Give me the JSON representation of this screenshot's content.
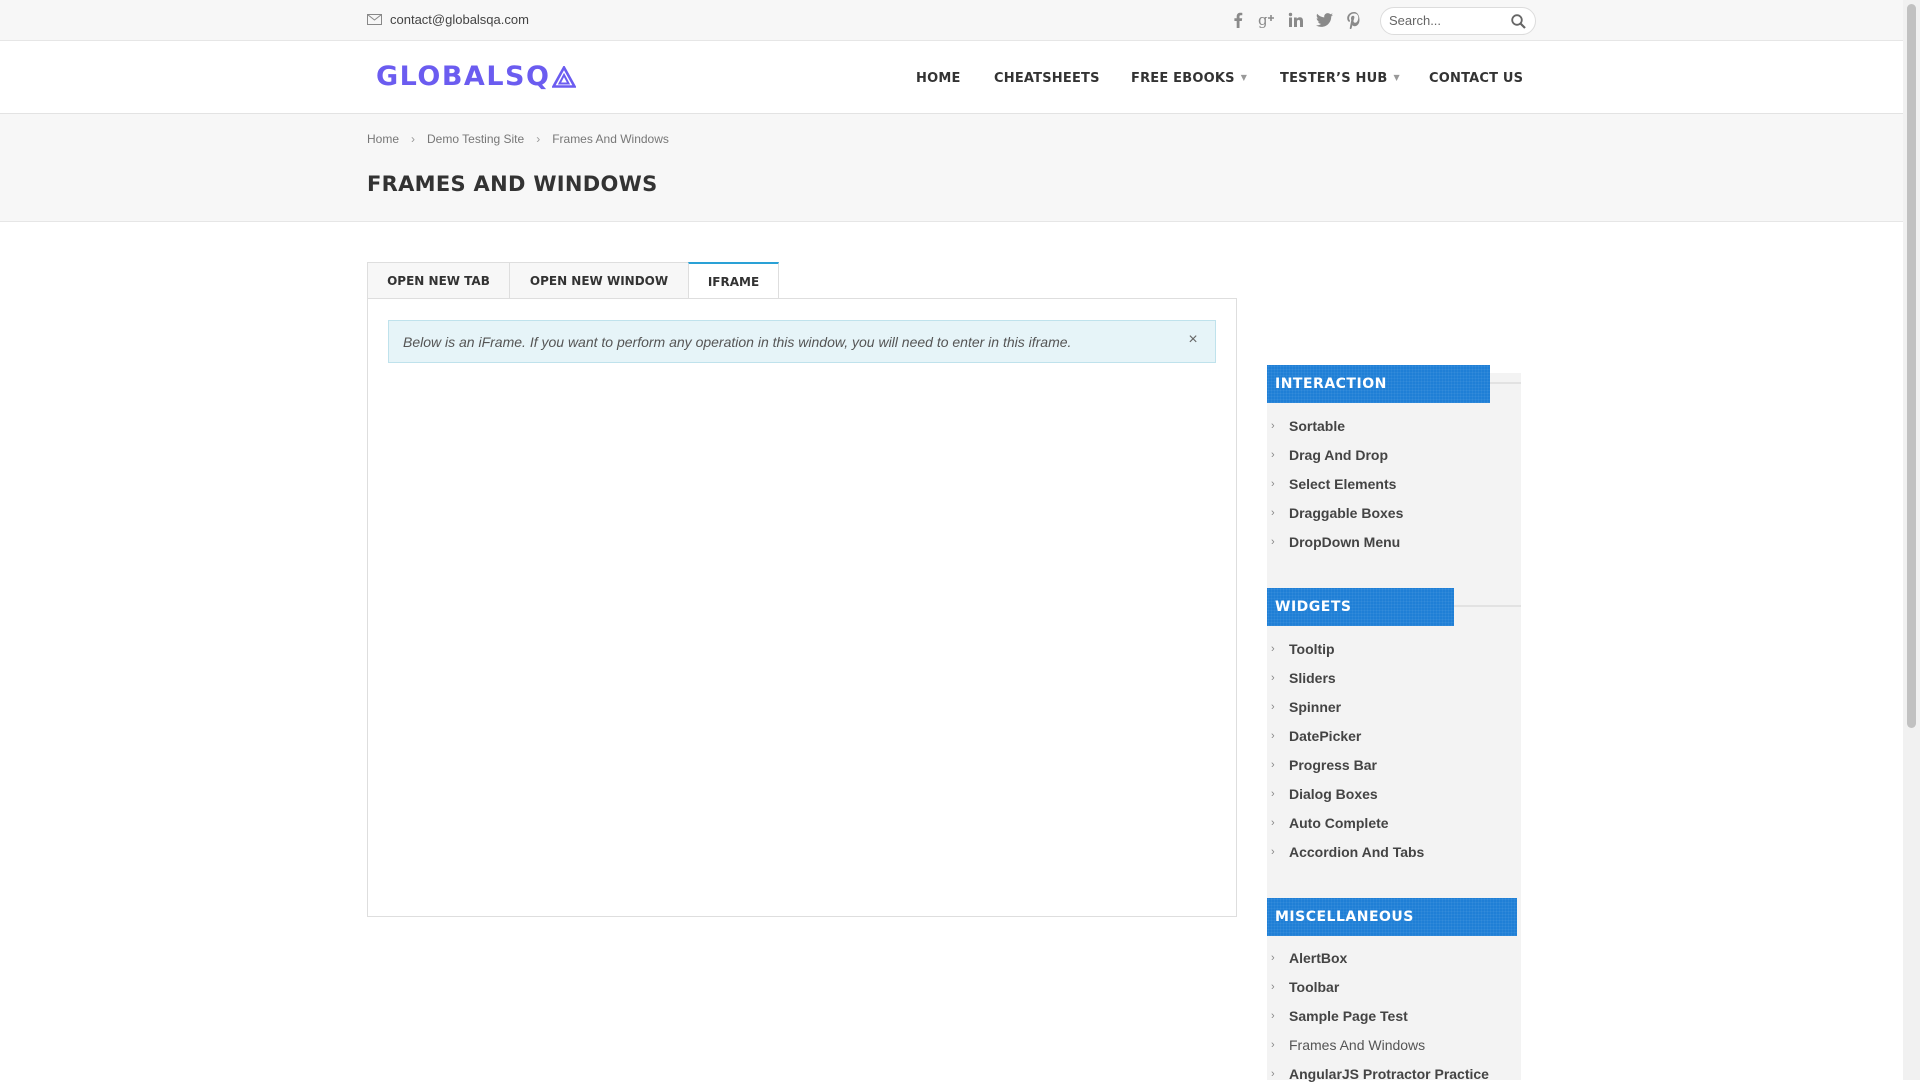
{
  "topbar": {
    "email": "contact@globalsqa.com",
    "socials": [
      "facebook-icon",
      "google-plus-icon",
      "linkedin-icon",
      "twitter-icon",
      "pinterest-icon"
    ],
    "search_placeholder": "Search..."
  },
  "header": {
    "logo_text": "GLOBALSQ",
    "nav": {
      "home": "HOME",
      "cheatsheets": "CHEATSHEETS",
      "free_ebooks": "FREE EBOOKS",
      "testers_hub": "TESTER’S HUB",
      "contact_us": "CONTACT US"
    }
  },
  "titleband": {
    "breadcrumb": [
      "Home",
      "Demo Testing Site",
      "Frames And Windows"
    ],
    "title": "FRAMES AND WINDOWS"
  },
  "tabs": [
    "OPEN NEW TAB",
    "OPEN NEW WINDOW",
    "IFRAME"
  ],
  "active_tab": "IFRAME",
  "panel": {
    "info_text": "Below is an iFrame. If you want to perform any operation in this window, you will need to enter in this iframe.",
    "close_glyph": "×"
  },
  "sidebar": {
    "interaction": {
      "title": "INTERACTION",
      "items": [
        "Sortable",
        "Drag And Drop",
        "Select Elements",
        "Draggable Boxes",
        "DropDown Menu"
      ]
    },
    "widgets": {
      "title": "WIDGETS",
      "items": [
        "Tooltip",
        "Sliders",
        "Spinner",
        "DatePicker",
        "Progress Bar",
        "Dialog Boxes",
        "Auto Complete",
        "Accordion And Tabs"
      ]
    },
    "miscellaneous": {
      "title": "MISCELLANEOUS",
      "items": [
        "AlertBox",
        "Toolbar",
        "Sample Page Test",
        "Frames And Windows",
        "AngularJS Protractor Practice"
      ]
    },
    "current_item": "Frames And Windows"
  },
  "colors": {
    "logo": "#6b5cf0",
    "accent_tab": "#2aa1d6",
    "widget_header": "#1f7fd6",
    "info_bg": "#e6f4f8"
  }
}
